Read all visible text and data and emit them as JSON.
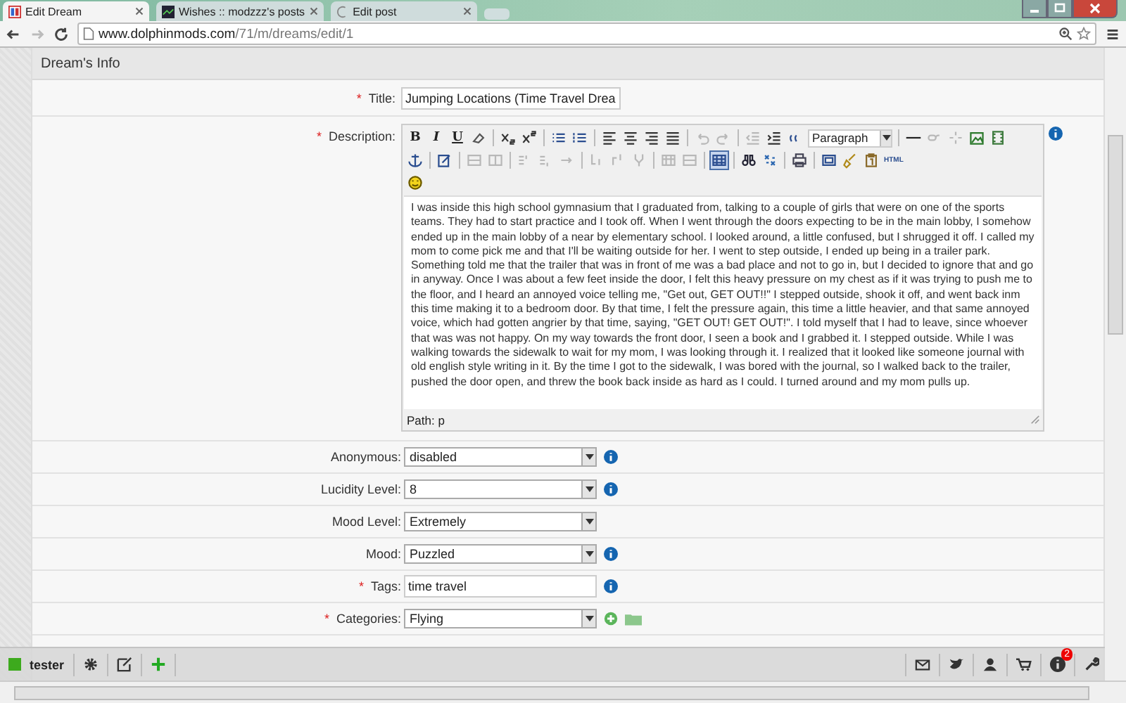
{
  "browser": {
    "tabs": [
      {
        "title": "Edit Dream",
        "kind": "site",
        "selected": true
      },
      {
        "title": "Wishes :: modzzz's posts",
        "kind": "forum",
        "selected": false
      },
      {
        "title": "Edit post",
        "kind": "loading",
        "selected": false
      }
    ],
    "url_host": "www.dolphinmods.com",
    "url_path": "/71/m/dreams/edit/1"
  },
  "panel": {
    "title": "Dream's Info"
  },
  "required_mark": "*",
  "title_field": {
    "label": "Title:",
    "required": true,
    "value": "Jumping Locations (Time Travel Drea"
  },
  "description": {
    "label": "Description:",
    "required": true,
    "format": "Paragraph",
    "toolbar_rows": [
      [
        [
          {
            "kind": "bold",
            "label": "B",
            "disabled": false
          },
          {
            "kind": "italic",
            "label": "I",
            "disabled": false
          },
          {
            "kind": "underline",
            "label": "U",
            "disabled": false
          },
          {
            "kind": "eraser",
            "disabled": false
          }
        ],
        [
          {
            "kind": "subscript",
            "disabled": false
          },
          {
            "kind": "superscript",
            "disabled": false
          }
        ],
        [
          {
            "kind": "bullets",
            "disabled": false
          },
          {
            "kind": "numbers",
            "disabled": false
          }
        ],
        [
          {
            "kind": "alignleft",
            "disabled": false
          },
          {
            "kind": "aligncenter",
            "disabled": false
          },
          {
            "kind": "alignright",
            "disabled": false
          },
          {
            "kind": "justify",
            "disabled": false
          }
        ],
        [
          {
            "kind": "undo",
            "disabled": true
          },
          {
            "kind": "redo",
            "disabled": true
          }
        ],
        [
          {
            "kind": "outdent",
            "disabled": true
          },
          {
            "kind": "indent",
            "disabled": false
          },
          {
            "kind": "quote",
            "disabled": false
          },
          {
            "kind": "format",
            "disabled": false
          }
        ],
        [
          {
            "kind": "rule",
            "disabled": false
          },
          {
            "kind": "link",
            "disabled": true
          },
          {
            "kind": "unlink",
            "disabled": true
          },
          {
            "kind": "image",
            "disabled": false
          },
          {
            "kind": "media",
            "disabled": false
          }
        ]
      ],
      [
        [
          {
            "kind": "anchor",
            "disabled": false
          }
        ],
        [
          {
            "kind": "edit",
            "disabled": false
          }
        ],
        [
          {
            "kind": "rowbefore",
            "disabled": true
          },
          {
            "kind": "rowafter",
            "disabled": true
          }
        ],
        [
          {
            "kind": "colbefore",
            "disabled": true
          },
          {
            "kind": "colafter",
            "disabled": true
          },
          {
            "kind": "coldelete",
            "disabled": true
          }
        ],
        [
          {
            "kind": "merge",
            "disabled": true
          },
          {
            "kind": "split",
            "disabled": true
          },
          {
            "kind": "fork",
            "disabled": true
          }
        ],
        [
          {
            "kind": "cellprops",
            "disabled": true
          },
          {
            "kind": "rowprops",
            "disabled": true
          }
        ],
        [
          {
            "kind": "table",
            "disabled": false
          }
        ],
        [
          {
            "kind": "find",
            "disabled": false
          },
          {
            "kind": "replace",
            "disabled": false
          }
        ],
        [
          {
            "kind": "print",
            "disabled": false
          }
        ],
        [
          {
            "kind": "fullscreen",
            "disabled": false
          },
          {
            "kind": "cleanup",
            "disabled": false
          },
          {
            "kind": "paste",
            "disabled": false
          },
          {
            "kind": "html",
            "label": "HTML",
            "disabled": false
          }
        ]
      ],
      [
        [
          {
            "kind": "smiley",
            "disabled": false
          }
        ]
      ]
    ],
    "text": "I was inside this high school gymnasium that I graduated from, talking to a couple of girls that were on one of the sports teams. They had to start practice and I took off. When I went through the doors expecting to be in the main lobby, I somehow ended up in the main lobby of a near by elementary school. I looked around, a little confused, but I shrugged it off. I called my mom to come pick me and that I'll be waiting outside for her. I went to step outside, I ended up being in a trailer park. Something told me that the trailer that was in front of me was a bad place and not to go in, but I decided to ignore that and go in anyway. Once I was about a few feet inside the door, I felt this heavy pressure on my chest as if it was trying to push me to the floor, and I heard an annoyed voice telling me, \"Get out, GET OUT!!\" I stepped outside, shook it off, and went back inm this time making it to a bedroom door. By that time, I felt the pressure again, this time a little heavier, and that same annoyed voice, which had gotten angrier by that time, saying, \"GET OUT! GET OUT!\". I told myself that I had to leave, since whoever that was was not happy. On my way towards the front door, I seen a book and I grabbed it. I stepped outside. While I was walking towards the sidewalk to wait for my mom, I was looking through it. I realized that it looked like someone journal with old english style writing in it. By the time I got to the sidewalk, I was bored with the journal, so I walked back to the trailer, pushed the door open, and threw the book back inside as hard as I could. I turned around and my mom pulls up.",
    "path": "Path: p"
  },
  "fields": [
    {
      "label": "Anonymous:",
      "kind": "select",
      "value": "disabled",
      "required": false,
      "info": true
    },
    {
      "label": "Lucidity Level:",
      "kind": "select",
      "value": "8",
      "required": false,
      "info": true
    },
    {
      "label": "Mood Level:",
      "kind": "select",
      "value": "Extremely",
      "required": false,
      "info": false
    },
    {
      "label": "Mood:",
      "kind": "select",
      "value": "Puzzled",
      "required": false,
      "info": true
    },
    {
      "label": "Tags:",
      "kind": "text",
      "value": "time travel",
      "required": true,
      "info": true
    },
    {
      "label": "Categories:",
      "kind": "picker",
      "value": "Flying",
      "required": true,
      "info": false
    }
  ],
  "bottom_bar": {
    "user": "tester",
    "notification_count": "2"
  }
}
